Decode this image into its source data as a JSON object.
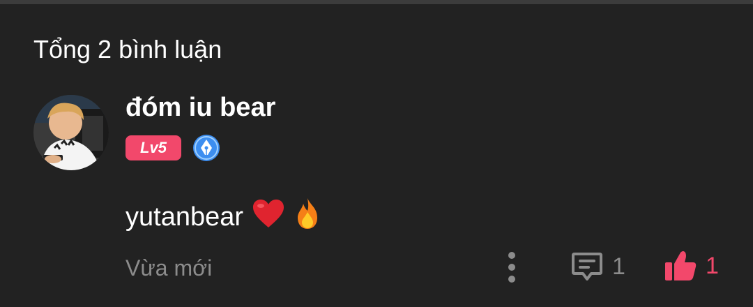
{
  "header": {
    "comment_total_label": "Tổng 2 bình luận"
  },
  "comment": {
    "username": "đóm iu bear",
    "level_badge": "Lv5",
    "text": "yutanbear",
    "emojis": [
      "heart",
      "fire"
    ],
    "timestamp": "Vừa mới",
    "reply_count": "1",
    "like_count": "1",
    "liked": true
  },
  "colors": {
    "background": "#222222",
    "accent": "#f2486b",
    "muted_text": "#8c8c8c",
    "verified_blue": "#3d8ef0"
  },
  "icons": {
    "more": "more-vertical-icon",
    "reply": "comment-icon",
    "like": "thumbs-up-icon",
    "verified": "pen-nib-badge-icon"
  }
}
